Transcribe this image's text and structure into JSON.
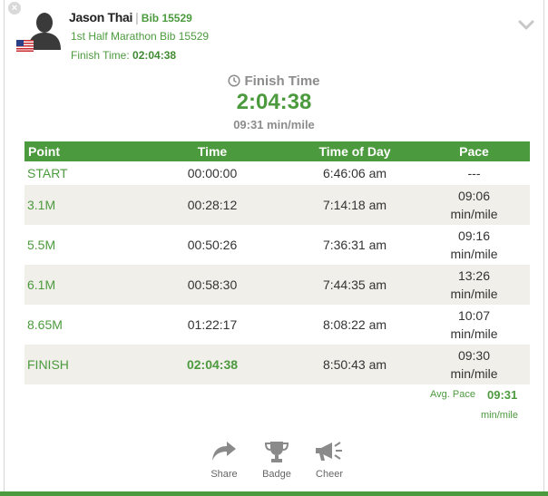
{
  "runner": {
    "name": "Jason Thai",
    "bib_label": "Bib 15529",
    "event_line": "1st Half Marathon Bib 15529",
    "finish_time_label": "Finish Time:",
    "finish_time_value": "02:04:38"
  },
  "summary": {
    "label": "Finish Time",
    "time": "2:04:38",
    "pace": "09:31 min/mile"
  },
  "table": {
    "headers": [
      "Point",
      "Time",
      "Time of Day",
      "Pace"
    ],
    "rows": [
      {
        "point": "START",
        "time": "00:00:00",
        "tod": "6:46:06 am",
        "pace": "---",
        "pace_unit": ""
      },
      {
        "point": "3.1M",
        "time": "00:28:12",
        "tod": "7:14:18 am",
        "pace": "09:06",
        "pace_unit": "min/mile"
      },
      {
        "point": "5.5M",
        "time": "00:50:26",
        "tod": "7:36:31 am",
        "pace": "09:16",
        "pace_unit": "min/mile"
      },
      {
        "point": "6.1M",
        "time": "00:58:30",
        "tod": "7:44:35 am",
        "pace": "13:26",
        "pace_unit": "min/mile"
      },
      {
        "point": "8.65M",
        "time": "01:22:17",
        "tod": "8:08:22 am",
        "pace": "10:07",
        "pace_unit": "min/mile"
      },
      {
        "point": "FINISH",
        "time": "02:04:38",
        "tod": "8:50:43 am",
        "pace": "09:30",
        "pace_unit": "min/mile"
      }
    ]
  },
  "avg_pace": {
    "label": "Avg. Pace",
    "value": "09:31",
    "unit": "min/mile"
  },
  "actions": {
    "share": "Share",
    "badge": "Badge",
    "cheer": "Cheer"
  },
  "colors": {
    "accent": "#4c9a3e",
    "row_alt": "#f0efea"
  }
}
